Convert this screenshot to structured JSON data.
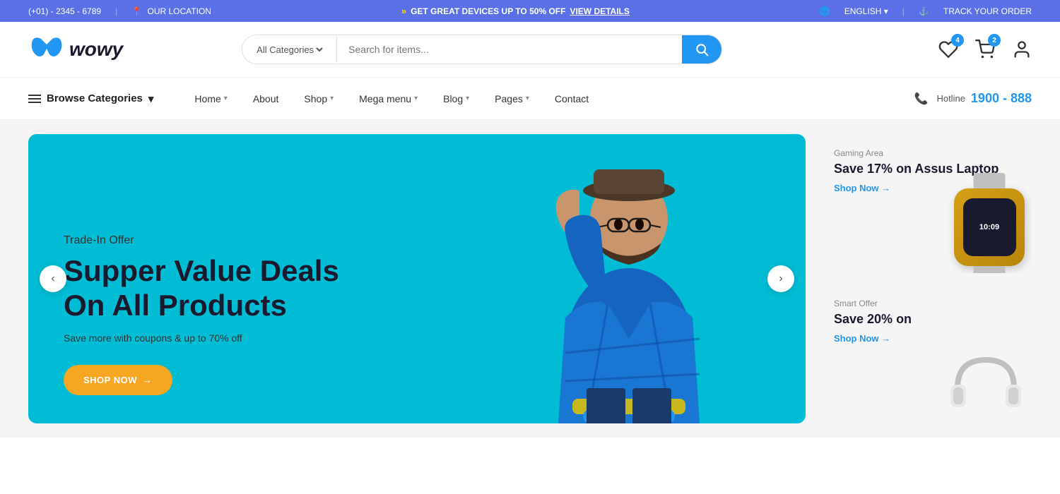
{
  "topbar": {
    "phone": "(+01) - 2345 - 6789",
    "location": "OUR LOCATION",
    "promo_arrows": "»",
    "promo_text": "GET GREAT DEVICES UP TO 50% OFF",
    "promo_link": "VIEW DETAILS",
    "language": "ENGLISH",
    "track_order": "TRACK YOUR ORDER"
  },
  "header": {
    "logo_text": "wowy",
    "search_placeholder": "Search for items...",
    "category_default": "All Categories",
    "wishlist_count": "4",
    "cart_count": "2"
  },
  "nav": {
    "browse_label": "Browse Categories",
    "links": [
      {
        "label": "Home",
        "has_dropdown": true
      },
      {
        "label": "About",
        "has_dropdown": false
      },
      {
        "label": "Shop",
        "has_dropdown": true
      },
      {
        "label": "Mega menu",
        "has_dropdown": true
      },
      {
        "label": "Blog",
        "has_dropdown": true
      },
      {
        "label": "Pages",
        "has_dropdown": true
      },
      {
        "label": "Contact",
        "has_dropdown": false
      }
    ],
    "hotline_label": "Hotline",
    "hotline_number": "1900 - 888"
  },
  "hero": {
    "tag": "Trade-In Offer",
    "title_line1": "Supper Value Deals",
    "title_line2": "On All Products",
    "subtitle": "Save more with coupons & up to 70% off",
    "btn_label": "SHOP NOW",
    "btn_arrow": "→"
  },
  "side_cards": [
    {
      "tag": "Gaming Area",
      "title": "Save 17% on Assus Laptop",
      "link": "Shop Now →"
    },
    {
      "tag": "Smart Offer",
      "title": "Save 20% on",
      "link": "Shop Now →"
    }
  ]
}
